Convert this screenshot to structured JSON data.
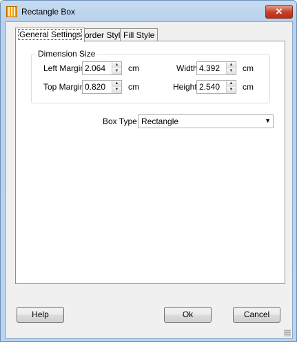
{
  "window": {
    "title": "Rectangle Box",
    "close_label": "✕",
    "app_icon": "rectangle-box-app-icon"
  },
  "tabs": [
    {
      "label": "General Settings",
      "active": true
    },
    {
      "label": "Border Style",
      "active": false
    },
    {
      "label": "Fill Style",
      "active": false
    }
  ],
  "dimension": {
    "group_title": "Dimension Size",
    "left_margin": {
      "label": "Left Margin",
      "value": "2.064",
      "unit": "cm"
    },
    "top_margin": {
      "label": "Top Margin",
      "value": "0.820",
      "unit": "cm"
    },
    "width": {
      "label": "Width",
      "value": "4.392",
      "unit": "cm"
    },
    "height": {
      "label": "Height",
      "value": "2.540",
      "unit": "cm"
    }
  },
  "box_type": {
    "label": "Box Type",
    "value": "Rectangle"
  },
  "buttons": {
    "help": "Help",
    "ok": "Ok",
    "cancel": "Cancel"
  },
  "colors": {
    "title_bar": "#bcd4ee",
    "close_button": "#c8432d",
    "dialog_bg": "#f0f0f0",
    "panel_bg": "#ffffff"
  }
}
